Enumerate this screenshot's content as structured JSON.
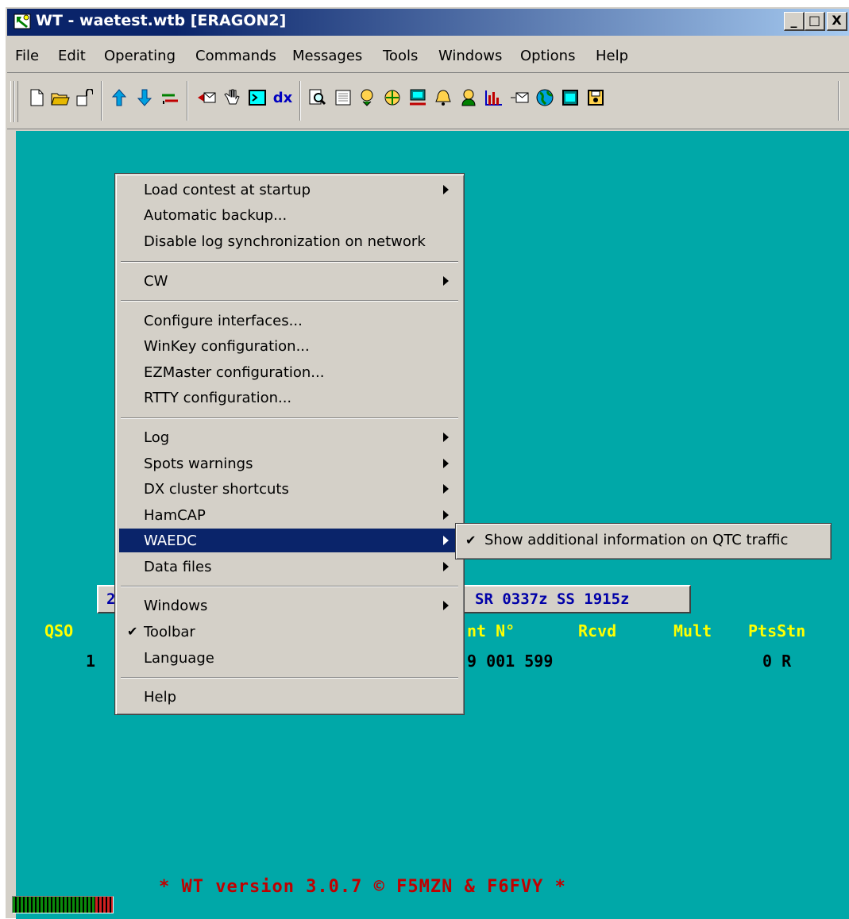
{
  "window": {
    "title": "WT - waetest.wtb [ERAGON2]",
    "min_label": "_",
    "max_label": "□",
    "close_label": "X"
  },
  "menubar": {
    "items": [
      "File",
      "Edit",
      "Operating",
      "Commands",
      "Messages",
      "Tools",
      "Windows",
      "Options",
      "Help"
    ]
  },
  "toolbar": {
    "icons": [
      "new-file-icon",
      "open-folder-icon",
      "open-icon",
      "up-arrow-icon",
      "down-arrow-icon",
      "transfer-icon",
      "send-message-icon",
      "hand-icon",
      "terminal-icon",
      "dx-icon",
      "search-icon",
      "list-icon",
      "spot-icon",
      "network-icon",
      "computer-icon",
      "bell-icon",
      "person-icon",
      "bar-chart-icon",
      "email-icon",
      "globe-icon",
      "window-icon",
      "save-icon"
    ],
    "dx_label": "dx"
  },
  "info_bar": {
    "left_text": "2.",
    "right_text": "SR 0337z SS 1915z"
  },
  "log": {
    "header_qso": "QSO",
    "header_sent": "nt N°",
    "header_rcvd": "Rcvd",
    "header_mult": "Mult",
    "header_pts": "PtsStn",
    "row_qso": "1",
    "row_sent": "9 001 599",
    "row_pts": "0 R"
  },
  "version_text": "* WT version 3.0.7 © F5MZN & F6FVY *",
  "options_menu": {
    "items": [
      {
        "label": "Load contest at startup",
        "submenu": true
      },
      {
        "label": "Automatic backup...",
        "submenu": false
      },
      {
        "label": "Disable log synchronization on network",
        "submenu": false
      },
      {
        "label": "CW",
        "submenu": true
      },
      {
        "label": "Configure interfaces...",
        "submenu": false
      },
      {
        "label": "WinKey configuration...",
        "submenu": false
      },
      {
        "label": "EZMaster configuration...",
        "submenu": false
      },
      {
        "label": "RTTY configuration...",
        "submenu": false
      },
      {
        "label": "Log",
        "submenu": true
      },
      {
        "label": "Spots warnings",
        "submenu": true
      },
      {
        "label": "DX cluster shortcuts",
        "submenu": true
      },
      {
        "label": "HamCAP",
        "submenu": true
      },
      {
        "label": "WAEDC",
        "submenu": true,
        "highlighted": true
      },
      {
        "label": "Data files",
        "submenu": true
      },
      {
        "label": "Windows",
        "submenu": true
      },
      {
        "label": "Toolbar",
        "submenu": false,
        "checked": true
      },
      {
        "label": "Language",
        "submenu": false
      },
      {
        "label": "Help",
        "submenu": false
      }
    ]
  },
  "waedc_submenu": {
    "item_label": "Show additional information on QTC traffic",
    "checked": true,
    "check_mark": "✔"
  },
  "colors": {
    "client_bg": "#00a8a8",
    "highlight": "#0a246a",
    "log_header": "#ffff00",
    "version_text": "#c00000",
    "info_text": "#0000a8"
  }
}
